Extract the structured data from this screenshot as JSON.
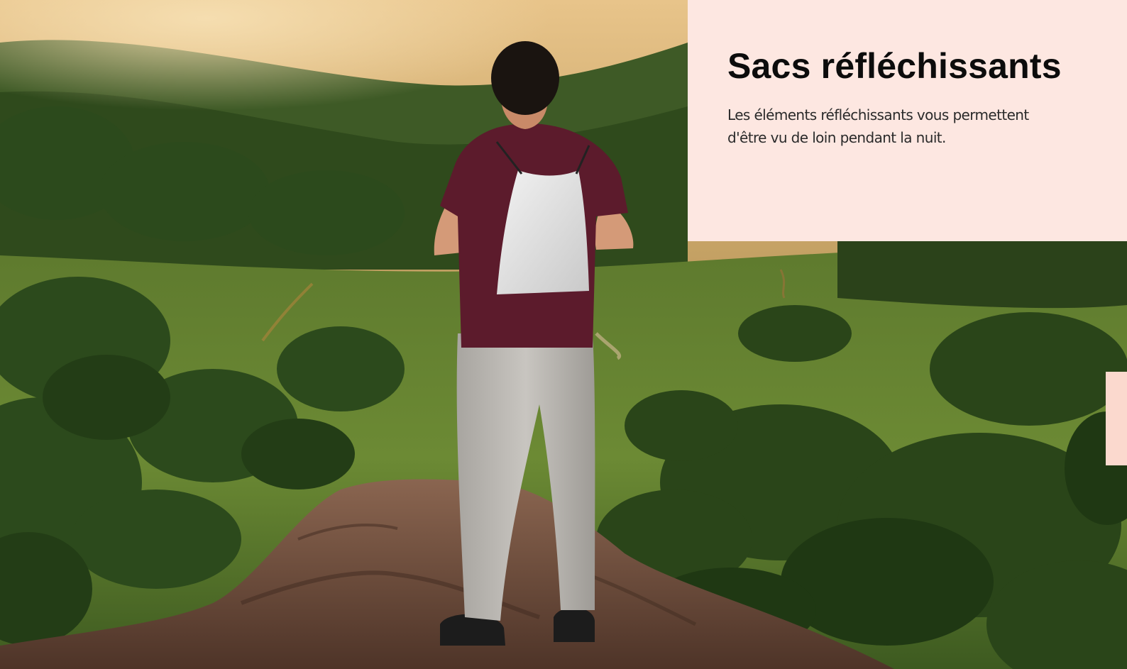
{
  "hero": {
    "image_alt": "Randonneur de dos portant un sac réfléchissant, debout sur un rocher face à une vallée boisée"
  },
  "card": {
    "title": "Sacs réfléchissants",
    "description": "Les éléments réfléchissants vous permettent d'être vu de loin pendant la nuit."
  },
  "colors": {
    "card_background": "#fde7e1",
    "side_tab": "#fbd9ce",
    "title_text": "#0c0c0c"
  }
}
